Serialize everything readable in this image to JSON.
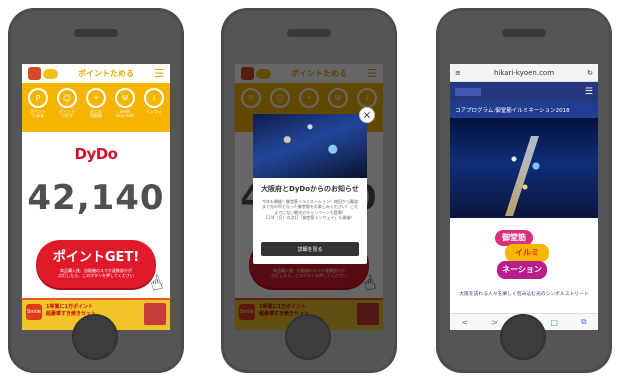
{
  "phone1": {
    "header": {
      "logo_text": "",
      "title": "ポイントためる",
      "menu_icon": "hamburger-icon"
    },
    "nav": [
      {
        "icon": "point-icon",
        "label": "ポイント\nためる"
      },
      {
        "icon": "smile-icon",
        "label": "ポイント\nつかう"
      },
      {
        "icon": "map-icon",
        "label": "近くの\n自販機"
      },
      {
        "icon": "fork-icon",
        "label": "Smile\nGourmet"
      },
      {
        "icon": "info-icon",
        "label": "インフォ"
      }
    ],
    "brand": "DyDo",
    "points": "42,140",
    "get_button": {
      "title": "ポイントGET!",
      "subtitle": "商品購入後、自販機のスマホ連携部分が\n点灯したら、このボタンを押してください"
    },
    "banner": {
      "left_badge": "Smile",
      "text": "1等賞に1万ポイント\n超豪華すき焼きセット",
      "right_badge": ""
    }
  },
  "phone2": {
    "modal": {
      "title": "大阪府とDyDoからのお知らせ",
      "body": "今年も開催！御堂筋イルミネーション！梅田から難波\nまで光の列となった御堂筋をお楽しみください！これ\nまでにない観光のキャンペーンも登場！\n11/4（日）の点灯「御堂筋ランウェイ」も開催！",
      "button": "詳細を見る",
      "close_icon": "close-icon"
    }
  },
  "phone3": {
    "browser": {
      "url": "hikari-kyoen.com",
      "reload_icon": "reload-icon",
      "menu_icon": "hamburger-icon"
    },
    "site": {
      "logo_text": "",
      "program_title": "コアプログラム:御堂筋イルミネーション2018",
      "logo_lines": [
        "御堂筋",
        "イルミ",
        "ネーション"
      ],
      "bottom_text": "大阪を訪れる人々を楽しく包み込む光のシンボルストリート"
    },
    "toolbar": [
      "<",
      ">",
      "⇪",
      "□",
      "⧉"
    ]
  }
}
